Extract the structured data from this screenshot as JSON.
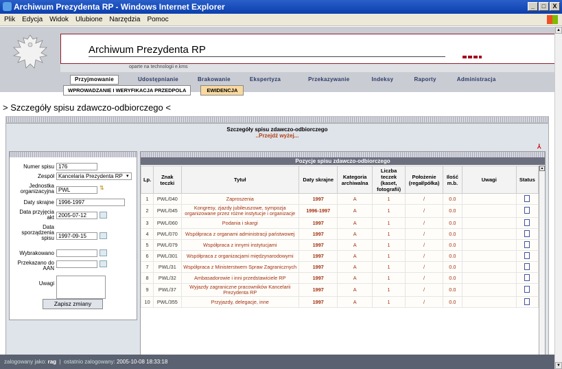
{
  "window": {
    "title": "Archiwum Prezydenta RP - Windows Internet Explorer",
    "buttons": [
      "_",
      "□",
      "X"
    ]
  },
  "menu": [
    "Plik",
    "Edycja",
    "Widok",
    "Ulubione",
    "Narzędzia",
    "Pomoc"
  ],
  "header": {
    "app_title": "Archiwum Prezydenta RP",
    "tagline": "oparte na technologii e.kms"
  },
  "nav": {
    "items": [
      "Przyjmowanie",
      "Udostępnianie",
      "Brakowanie",
      "Ekspertyza",
      "Przekazywanie",
      "Indeksy",
      "Raporty",
      "Administracja"
    ],
    "active": "Przyjmowanie"
  },
  "subnav": {
    "items": [
      "WPROWADZANIE I WERYFIKACJA PRZEDPOLA",
      "EWIDENCJA"
    ],
    "active": "EWIDENCJA"
  },
  "page": {
    "title": "> Szczegóły spisu zdawczo-odbiorczego <",
    "panel_title": "Szczegóły spisu zdawczo-odbiorczego",
    "panel_link": "..Przejdź wyżej..."
  },
  "form": {
    "numer_spisu": {
      "label": "Numer spisu",
      "value": "176"
    },
    "zespol": {
      "label": "Zespół",
      "value": "Kancelaria Prezydenta RP"
    },
    "jednostka": {
      "label": "Jednostka organizacyjna",
      "value": "PWL"
    },
    "daty_skrajne": {
      "label": "Daty skrajne",
      "value": "1996-1997"
    },
    "data_przyjecia": {
      "label": "Data przyjęcia akt",
      "value": "2005-07-12"
    },
    "data_sporzadzenia": {
      "label": "Data sporządzenia spisu",
      "value": "1997-09-15"
    },
    "wybrakowano": {
      "label": "Wybrakowano",
      "value": ""
    },
    "przekazano": {
      "label": "Przekazano do AAN",
      "value": ""
    },
    "uwagi": {
      "label": "Uwagi",
      "value": ""
    },
    "save_label": "Zapisz zmiany"
  },
  "table": {
    "title": "Pozycje spisu zdawczo-odbiorczego",
    "columns": [
      "Lp.",
      "Znak teczki",
      "Tytuł",
      "Daty skrajne",
      "Kategoria archiwalna",
      "Liczba teczek (kaset, fotografii)",
      "Położenie (regał/półka)",
      "Ilość m.b.",
      "Uwagi",
      "Status"
    ],
    "rows": [
      [
        "1",
        "PWL/040",
        "Zaproszenia",
        "1997",
        "A",
        "1",
        "/",
        "0.0",
        ""
      ],
      [
        "2",
        "PWL/045",
        "Kongresy, zjazdy jubileuszowe, sympozja organizowane przez różne instytucje i organizacje",
        "1996-1997",
        "A",
        "1",
        "/",
        "0.0",
        ""
      ],
      [
        "3",
        "PWL/060",
        "Podania i skargi",
        "1997",
        "A",
        "1",
        "/",
        "0.0",
        ""
      ],
      [
        "4",
        "PWL/070",
        "Współpraca z organami administracji państwowej",
        "1997",
        "A",
        "1",
        "/",
        "0.0",
        ""
      ],
      [
        "5",
        "PWL/079",
        "Współpraca z innymi instytucjami",
        "1997",
        "A",
        "1",
        "/",
        "0.0",
        ""
      ],
      [
        "6",
        "PWL/301",
        "Współpraca z organizacjami międzynarodowymi",
        "1997",
        "A",
        "1",
        "/",
        "0.0",
        ""
      ],
      [
        "7",
        "PWL/31",
        "Współpraca z Ministerstwem Spraw Zagranicznych",
        "1997",
        "A",
        "1",
        "/",
        "0.0",
        ""
      ],
      [
        "8",
        "PWL/32",
        "Ambasadorowie i inni przedstawiciele RP",
        "1997",
        "A",
        "1",
        "/",
        "0.0",
        ""
      ],
      [
        "9",
        "PWL/37",
        "Wyjazdy zagraniczne pracowników Kancelarii Prezydenta RP",
        "1997",
        "A",
        "1",
        "/",
        "0.0",
        ""
      ],
      [
        "10",
        "PWL/355",
        "Przyjazdy, delegacje, inne",
        "1997",
        "A",
        "1",
        "/",
        "0.0",
        ""
      ]
    ]
  },
  "status": {
    "user_label": "zalogowany jako:",
    "user": "rag",
    "last_label": "ostatnio zalogowany:",
    "last": "2005-10-08 18:33:18"
  }
}
